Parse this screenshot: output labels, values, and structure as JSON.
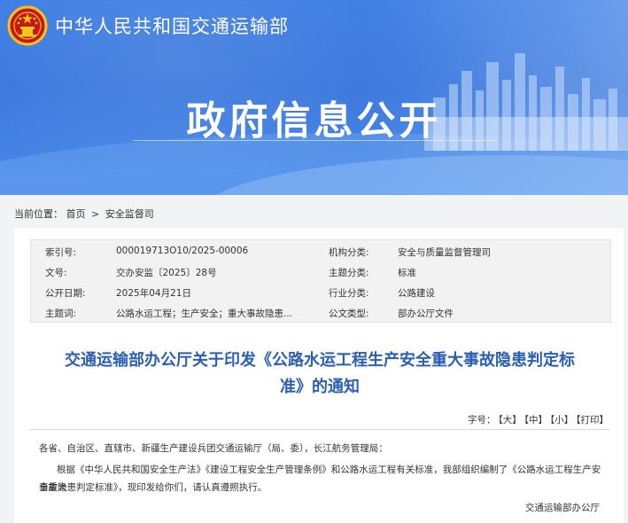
{
  "header": {
    "ministry_name": "中华人民共和国交通运输部",
    "section_title": "政府信息公开"
  },
  "breadcrumb": {
    "prefix": "当前位置：",
    "home": "首页",
    "separator": ">",
    "current": "安全监督司"
  },
  "metadata": [
    {
      "label": "索引号:",
      "value": "000019713O10/2025-00006"
    },
    {
      "label": "机构分类:",
      "value": "安全与质量监督管理司"
    },
    {
      "label": "文号:",
      "value": "交办安监〔2025〕28号"
    },
    {
      "label": "主题分类:",
      "value": "标准"
    },
    {
      "label": "公开日期:",
      "value": "2025年04月21日"
    },
    {
      "label": "行业分类:",
      "value": "公路建设"
    },
    {
      "label": "主题词:",
      "value": "公路水运工程；生产安全；重大事故隐患..."
    },
    {
      "label": "公文类型:",
      "value": "部办公厅文件"
    }
  ],
  "document": {
    "title_line1": "交通运输部办公厅关于印发《公路水运工程生产安全重大事故隐患判定标",
    "title_line2": "准》的通知",
    "addressee": "各省、自治区、直辖市、新疆生产建设兵团交通运输厅（局、委），长江航务管理局：",
    "para_line1": "根据《中华人民共和国安全生产法》《建设工程安全生产管理条例》和公路水运工程有关标准，我部组织编制了《公路水运工程生产安全重大",
    "para_line2": "事故隐患判定标准》，现印发给你们，请认真遵照执行。",
    "signature": "交通运输部办公厅"
  },
  "font_size_bar": {
    "label": "字号：",
    "large": "【大】",
    "medium": "【中】",
    "small": "【小】",
    "print": "【打印】"
  },
  "colors": {
    "banner_blue": "#3f7fe3",
    "title_blue": "#2a5fb3",
    "emblem_red": "#c8161d",
    "emblem_gold": "#f5c518"
  },
  "icons": {
    "emblem": "national-emblem-icon"
  }
}
